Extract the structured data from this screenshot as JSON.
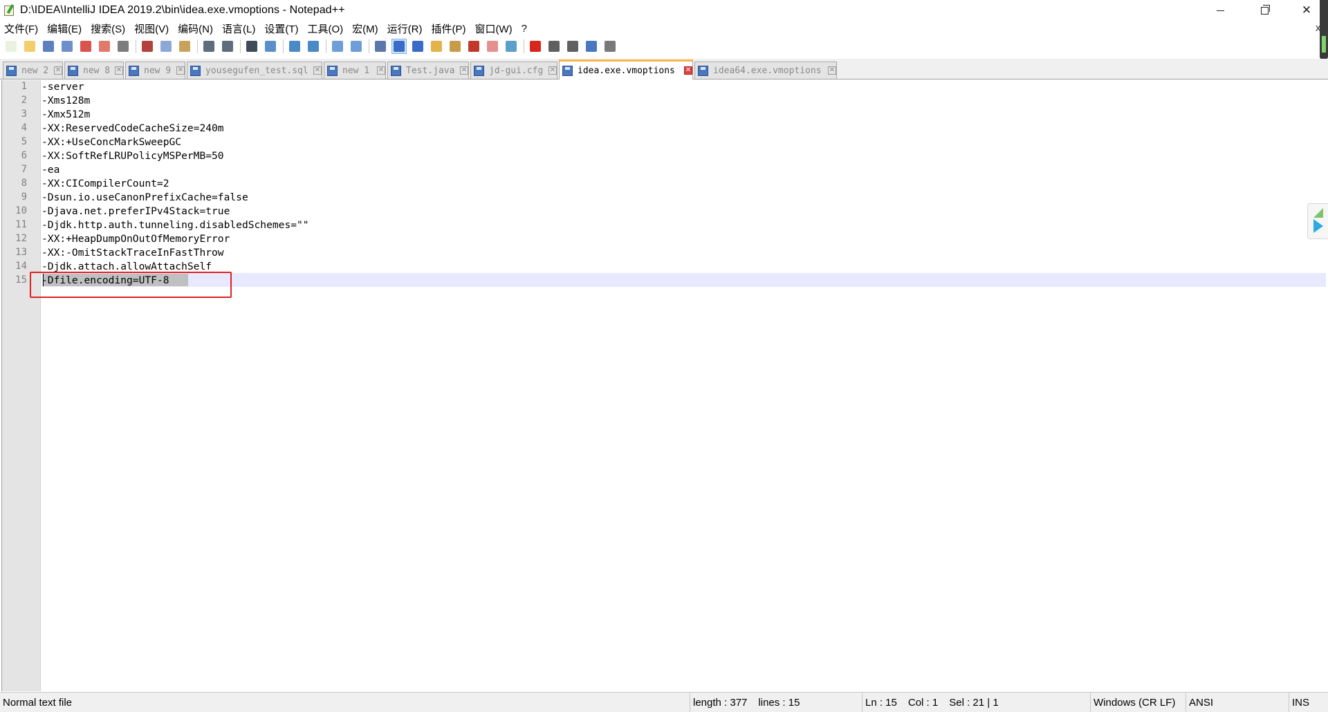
{
  "window": {
    "title": "D:\\IDEA\\IntelliJ IDEA 2019.2\\bin\\idea.exe.vmoptions - Notepad++",
    "minimize_glyph": "",
    "close_glyph": "✕"
  },
  "menu": {
    "items": [
      "文件(F)",
      "编辑(E)",
      "搜索(S)",
      "视图(V)",
      "编码(N)",
      "语言(L)",
      "设置(T)",
      "工具(O)",
      "宏(M)",
      "运行(R)",
      "插件(P)",
      "窗口(W)",
      "?"
    ],
    "close_glyph": "x"
  },
  "toolbar": {
    "buttons": [
      {
        "name": "new-file-icon",
        "color": "#e9f2e0"
      },
      {
        "name": "open-file-icon",
        "color": "#f3cf6b"
      },
      {
        "name": "save-icon",
        "color": "#5b7fbf"
      },
      {
        "name": "save-all-icon",
        "color": "#6d8fca"
      },
      {
        "name": "close-file-icon",
        "color": "#d9534f"
      },
      {
        "name": "close-all-icon",
        "color": "#e07a6b"
      },
      {
        "name": "print-icon",
        "color": "#7d7d7d"
      },
      {
        "name": "cut-icon",
        "color": "#b4413c"
      },
      {
        "name": "copy-icon",
        "color": "#8da8d8"
      },
      {
        "name": "paste-icon",
        "color": "#c9a25a"
      },
      {
        "name": "undo-icon",
        "color": "#5d6d7e"
      },
      {
        "name": "redo-icon",
        "color": "#5d6d7e"
      },
      {
        "name": "find-icon",
        "color": "#3f4a5a"
      },
      {
        "name": "replace-icon",
        "color": "#5a8fc9"
      },
      {
        "name": "zoom-in-icon",
        "color": "#4a8ac6"
      },
      {
        "name": "zoom-out-icon",
        "color": "#4a8ac6"
      },
      {
        "name": "sync-vertical-icon",
        "color": "#6f9dd8"
      },
      {
        "name": "sync-horizontal-icon",
        "color": "#6f9dd8"
      },
      {
        "name": "word-wrap-icon",
        "color": "#5c77a8"
      },
      {
        "name": "show-all-chars-icon",
        "color": "#3a6bc8"
      },
      {
        "name": "indent-guide-icon",
        "color": "#3a6bc8"
      },
      {
        "name": "udl-icon",
        "color": "#e2b34a"
      },
      {
        "name": "doc-map-icon",
        "color": "#c79b48"
      },
      {
        "name": "function-list-icon",
        "color": "#c0392b"
      },
      {
        "name": "folder-workspace-icon",
        "color": "#e58f8f"
      },
      {
        "name": "monitoring-icon",
        "color": "#5aa0c8"
      },
      {
        "name": "record-macro-icon",
        "color": "#d9261c"
      },
      {
        "name": "stop-macro-icon",
        "color": "#606060"
      },
      {
        "name": "play-macro-icon",
        "color": "#606060"
      },
      {
        "name": "run-macro-multiple-icon",
        "color": "#4a78c0"
      },
      {
        "name": "save-macro-icon",
        "color": "#7a7a7a"
      }
    ],
    "active_index": 19
  },
  "tabs": [
    {
      "label": "new 2",
      "active": false
    },
    {
      "label": "new 8",
      "active": false
    },
    {
      "label": "new 9",
      "active": false
    },
    {
      "label": "yousegufen_test.sql",
      "active": false
    },
    {
      "label": "new 1",
      "active": false
    },
    {
      "label": "Test.java",
      "active": false
    },
    {
      "label": "jd-gui.cfg",
      "active": false
    },
    {
      "label": "idea.exe.vmoptions",
      "active": true
    },
    {
      "label": "idea64.exe.vmoptions",
      "active": false
    }
  ],
  "editor": {
    "lines": [
      "-server",
      "-Xms128m",
      "-Xmx512m",
      "-XX:ReservedCodeCacheSize=240m",
      "-XX:+UseConcMarkSweepGC",
      "-XX:SoftRefLRUPolicyMSPerMB=50",
      "-ea",
      "-XX:CICompilerCount=2",
      "-Dsun.io.useCanonPrefixCache=false",
      "-Djava.net.preferIPv4Stack=true",
      "-Djdk.http.auth.tunneling.disabledSchemes=\"\"",
      "-XX:+HeapDumpOnOutOfMemoryError",
      "-XX:-OmitStackTraceInFastThrow",
      "-Djdk.attach.allowAttachSelf",
      "-Dfile.encoding=UTF-8"
    ],
    "line_numbers": [
      "1",
      "2",
      "3",
      "4",
      "5",
      "6",
      "7",
      "8",
      "9",
      "10",
      "11",
      "12",
      "13",
      "14",
      "15"
    ],
    "current_line": 15
  },
  "status": {
    "file_type": "Normal text file",
    "length": "length : 377",
    "lines": "lines : 15",
    "ln": "Ln : 15",
    "col": "Col : 1",
    "sel": "Sel : 21 | 1",
    "eol": "Windows (CR LF)",
    "encoding": "ANSI",
    "mode": "INS"
  },
  "colors": {
    "accent_tab": "#fab34a",
    "highlight_box": "#e02020",
    "current_line_bg": "#e8e8ff",
    "selection_bg": "#c0c0c0"
  }
}
